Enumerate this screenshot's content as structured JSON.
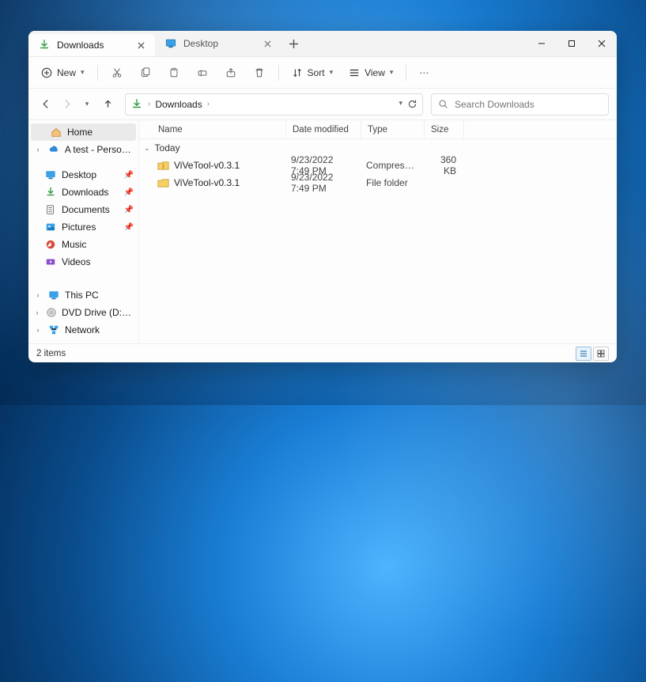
{
  "tabs": [
    {
      "label": "Downloads",
      "active": true
    },
    {
      "label": "Desktop",
      "active": false
    }
  ],
  "toolbar": {
    "new_label": "New",
    "sort_label": "Sort",
    "view_label": "View"
  },
  "address": {
    "segment": "Downloads"
  },
  "search": {
    "placeholder": "Search Downloads"
  },
  "sidebar": {
    "home": "Home",
    "personal": "A test - Personal",
    "desktop": "Desktop",
    "downloads": "Downloads",
    "documents": "Documents",
    "pictures": "Pictures",
    "music": "Music",
    "videos": "Videos",
    "thispc": "This PC",
    "dvd": "DVD Drive (D:) CCC",
    "network": "Network"
  },
  "columns": {
    "name": "Name",
    "date": "Date modified",
    "type": "Type",
    "size": "Size"
  },
  "group_today": "Today",
  "rows": [
    {
      "name": "ViVeTool-v0.3.1",
      "date": "9/23/2022 7:49 PM",
      "type": "Compressed (zipp...",
      "size": "360 KB",
      "kind": "zip"
    },
    {
      "name": "ViVeTool-v0.3.1",
      "date": "9/23/2022 7:49 PM",
      "type": "File folder",
      "size": "",
      "kind": "folder"
    }
  ],
  "status": {
    "text": "2 items"
  }
}
